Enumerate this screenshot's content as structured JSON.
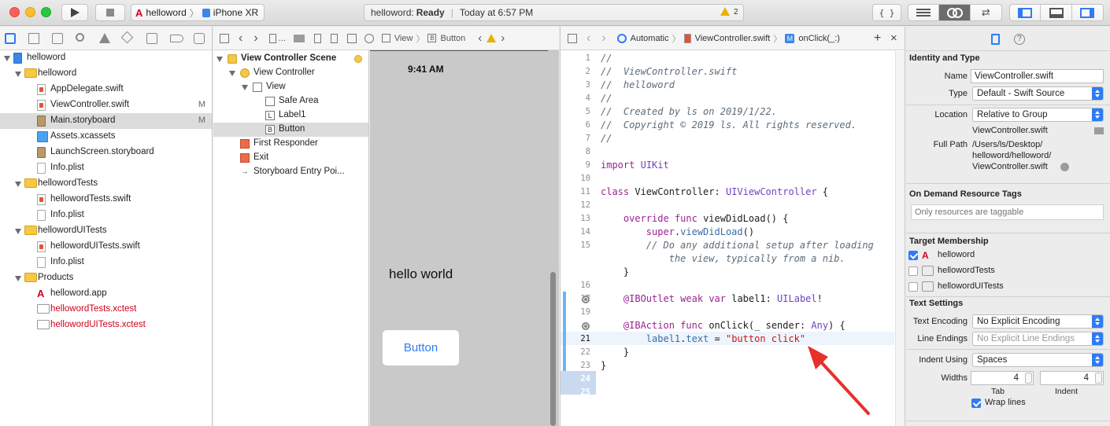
{
  "toolbar": {
    "scheme_name": "helloword",
    "device_name": "iPhone XR",
    "status_project": "helloword:",
    "status_state": "Ready",
    "status_time": "Today at 6:57 PM",
    "warning_count": "2",
    "code_review_label": "{ }"
  },
  "navigator": {
    "items": [
      {
        "label": "helloword",
        "kind": "project",
        "mark": ""
      },
      {
        "label": "helloword",
        "kind": "folder",
        "mark": ""
      },
      {
        "label": "AppDelegate.swift",
        "kind": "swift",
        "mark": ""
      },
      {
        "label": "ViewController.swift",
        "kind": "swift",
        "mark": "M"
      },
      {
        "label": "Main.storyboard",
        "kind": "storyboard",
        "mark": "M"
      },
      {
        "label": "Assets.xcassets",
        "kind": "assets",
        "mark": ""
      },
      {
        "label": "LaunchScreen.storyboard",
        "kind": "storyboard",
        "mark": ""
      },
      {
        "label": "Info.plist",
        "kind": "file",
        "mark": ""
      },
      {
        "label": "hellowordTests",
        "kind": "folder",
        "mark": ""
      },
      {
        "label": "hellowordTests.swift",
        "kind": "swift",
        "mark": ""
      },
      {
        "label": "Info.plist",
        "kind": "file",
        "mark": ""
      },
      {
        "label": "hellowordUITests",
        "kind": "folder",
        "mark": ""
      },
      {
        "label": "hellowordUITests.swift",
        "kind": "swift",
        "mark": ""
      },
      {
        "label": "Info.plist",
        "kind": "file",
        "mark": ""
      },
      {
        "label": "Products",
        "kind": "folder",
        "mark": ""
      },
      {
        "label": "helloword.app",
        "kind": "app",
        "mark": ""
      },
      {
        "label": "hellowordTests.xctest",
        "kind": "missing",
        "mark": ""
      },
      {
        "label": "hellowordUITests.xctest",
        "kind": "missing",
        "mark": ""
      }
    ]
  },
  "ib_jumpbar": {
    "crumbs": [
      "...",
      "View",
      "Button"
    ]
  },
  "outline": {
    "items": [
      {
        "label": "View Controller Scene"
      },
      {
        "label": "View Controller"
      },
      {
        "label": "View"
      },
      {
        "label": "Safe Area"
      },
      {
        "label": "Label1"
      },
      {
        "label": "Button"
      },
      {
        "label": "First Responder"
      },
      {
        "label": "Exit"
      },
      {
        "label": "Storyboard Entry Poi..."
      }
    ]
  },
  "canvas": {
    "status_time": "9:41 AM",
    "label_text": "hello world",
    "button_text": "Button"
  },
  "editor_jumpbar": {
    "mode": "Automatic",
    "file": "ViewController.swift",
    "method": "onClick(_:)",
    "add_label": "+",
    "close_label": "×"
  },
  "code_lines": [
    {
      "n": "1",
      "t": "//"
    },
    {
      "n": "2",
      "t": "//  ViewController.swift"
    },
    {
      "n": "3",
      "t": "//  helloword"
    },
    {
      "n": "4",
      "t": "//"
    },
    {
      "n": "5",
      "t": "//  Created by ls on 2019/1/22."
    },
    {
      "n": "6",
      "t": "//  Copyright © 2019 ls. All rights reserved."
    },
    {
      "n": "7",
      "t": "//"
    },
    {
      "n": "8",
      "t": ""
    },
    {
      "n": "9",
      "t": "import UIKit"
    },
    {
      "n": "10",
      "t": ""
    },
    {
      "n": "11",
      "t": "class ViewController: UIViewController {"
    },
    {
      "n": "12",
      "t": ""
    },
    {
      "n": "13",
      "t": "    override func viewDidLoad() {"
    },
    {
      "n": "14",
      "t": "        super.viewDidLoad()"
    },
    {
      "n": "15",
      "t": "        // Do any additional setup after loading"
    },
    {
      "n": "",
      "t": "            the view, typically from a nib."
    },
    {
      "n": "",
      "t": "    }"
    },
    {
      "n": "16",
      "t": ""
    },
    {
      "n": "17",
      "t": "    @IBOutlet weak var label1: UILabel!"
    },
    {
      "n": "19",
      "t": ""
    },
    {
      "n": "",
      "t": "    @IBAction func onClick(_ sender: Any) {"
    },
    {
      "n": "21",
      "t": "        label1.text = \"button click\""
    },
    {
      "n": "22",
      "t": "    }"
    },
    {
      "n": "23",
      "t": "}"
    },
    {
      "n": "24",
      "t": ""
    },
    {
      "n": "25",
      "t": ""
    }
  ],
  "inspector": {
    "identity_header": "Identity and Type",
    "name_label": "Name",
    "name_value": "ViewController.swift",
    "type_label": "Type",
    "type_value": "Default - Swift Source",
    "location_label": "Location",
    "location_value": "Relative to Group",
    "location_file": "ViewController.swift",
    "fullpath_label": "Full Path",
    "fullpath_1": "/Users/ls/Desktop/",
    "fullpath_2": "helloword/helloword/",
    "fullpath_3": "ViewController.swift",
    "ondemand_header": "On Demand Resource Tags",
    "tags_placeholder": "Only resources are taggable",
    "target_header": "Target Membership",
    "targets": [
      {
        "label": "helloword",
        "checked": true
      },
      {
        "label": "hellowordTests",
        "checked": false
      },
      {
        "label": "hellowordUITests",
        "checked": false
      }
    ],
    "text_header": "Text Settings",
    "encoding_label": "Text Encoding",
    "encoding_value": "No Explicit Encoding",
    "endings_label": "Line Endings",
    "endings_value": "No Explicit Line Endings",
    "indent_label": "Indent Using",
    "indent_value": "Spaces",
    "widths_label": "Widths",
    "tab_value": "4",
    "indent_width_value": "4",
    "tab_caption": "Tab",
    "indent_caption": "Indent",
    "wrap_label": "Wrap lines"
  },
  "colors": {
    "accent": "#2f7bf5",
    "selection": "#dcdcdc",
    "missing_file": "#d0021b",
    "annotation_arrow": "#e8302a"
  }
}
